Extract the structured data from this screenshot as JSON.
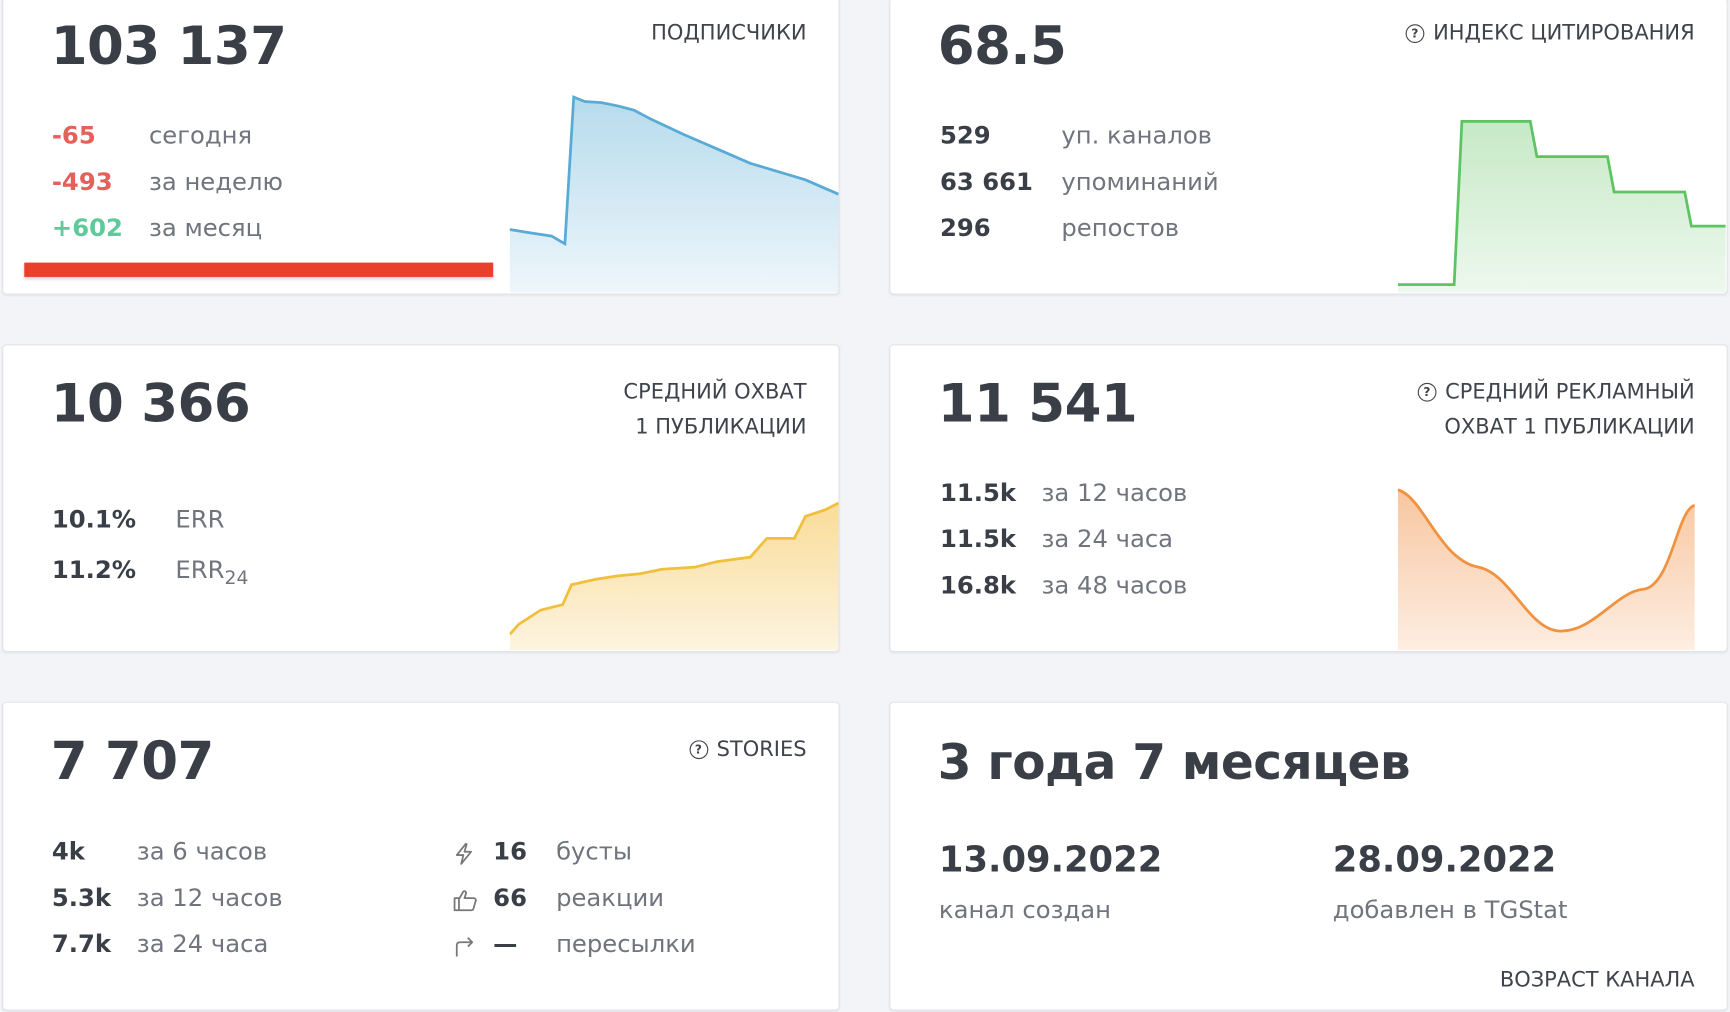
{
  "subscribers": {
    "value": "103 137",
    "label": "ПОДПИСЧИКИ",
    "rows": [
      {
        "value": "-65",
        "label": "сегодня"
      },
      {
        "value": "-493",
        "label": "за неделю"
      },
      {
        "value": "+602",
        "label": "за месяц"
      }
    ]
  },
  "citation": {
    "value": "68.5",
    "label": "ИНДЕКС ЦИТИРОВАНИЯ",
    "rows": [
      {
        "value": "529",
        "label": "уп. каналов"
      },
      {
        "value": "63 661",
        "label": "упоминаний"
      },
      {
        "value": "296",
        "label": "репостов"
      }
    ]
  },
  "reach": {
    "value": "10 366",
    "label_line1": "СРЕДНИЙ ОХВАТ",
    "label_line2": "1 ПУБЛИКАЦИИ",
    "rows": [
      {
        "value": "10.1%",
        "label": "ERR"
      },
      {
        "value": "11.2%",
        "label": "ERR",
        "sub": "24"
      }
    ]
  },
  "ad_reach": {
    "value": "11 541",
    "label_line1": "СРЕДНИЙ РЕКЛАМНЫЙ",
    "label_line2": "ОХВАТ 1 ПУБЛИКАЦИИ",
    "rows": [
      {
        "value": "11.5k",
        "label": "за 12 часов"
      },
      {
        "value": "11.5k",
        "label": "за 24 часа"
      },
      {
        "value": "16.8k",
        "label": "за 48 часов"
      }
    ]
  },
  "stories": {
    "value": "7 707",
    "label": "STORIES",
    "rows": [
      {
        "value": "4k",
        "label": "за 6 часов"
      },
      {
        "value": "5.3k",
        "label": "за 12 часов"
      },
      {
        "value": "7.7k",
        "label": "за 24 часа"
      }
    ],
    "stats": [
      {
        "icon": "lightning-icon",
        "value": "16",
        "label": "бусты"
      },
      {
        "icon": "thumbs-up-icon",
        "value": "66",
        "label": "реакции"
      },
      {
        "icon": "forward-arrow-icon",
        "value": "—",
        "label": "пересылки"
      }
    ]
  },
  "age": {
    "value": "3 года 7 месяцев",
    "created_date": "13.09.2022",
    "created_label": "канал создан",
    "added_date": "28.09.2022",
    "added_label": "добавлен в TGStat",
    "label": "ВОЗРАСТ КАНАЛА"
  },
  "colors": {
    "blue": "#5aaad6",
    "green": "#5cc463",
    "yellow": "#f0bf3c",
    "orange": "#ef9340",
    "red_bar": "#e8402a"
  }
}
